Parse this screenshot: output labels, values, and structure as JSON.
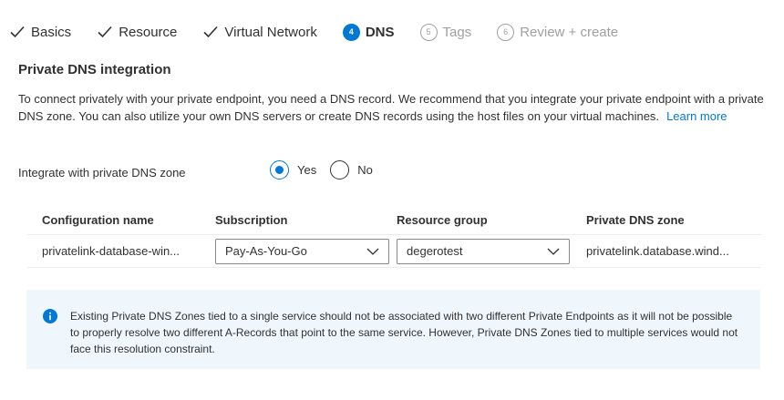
{
  "tabs": [
    {
      "label": "Basics",
      "state": "complete"
    },
    {
      "label": "Resource",
      "state": "complete"
    },
    {
      "label": "Virtual Network",
      "state": "complete"
    },
    {
      "label": "DNS",
      "state": "active",
      "step": "4"
    },
    {
      "label": "Tags",
      "state": "disabled",
      "step": "5"
    },
    {
      "label": "Review + create",
      "state": "disabled",
      "step": "6"
    }
  ],
  "section": {
    "title": "Private DNS integration",
    "description": "To connect privately with your private endpoint, you need a DNS record. We recommend that you integrate your private endpoint with a private DNS zone. You can also utilize your own DNS servers or create DNS records using the host files on your virtual machines.",
    "learn_more": "Learn more"
  },
  "integrate": {
    "label": "Integrate with private DNS zone",
    "options": {
      "yes": "Yes",
      "no": "No"
    },
    "selected": "yes"
  },
  "table": {
    "headers": {
      "config_name": "Configuration name",
      "subscription": "Subscription",
      "resource_group": "Resource group",
      "private_dns_zone": "Private DNS zone"
    },
    "rows": [
      {
        "config_name": "privatelink-database-win...",
        "subscription": "Pay-As-You-Go",
        "resource_group": "degerotest",
        "private_dns_zone": "privatelink.database.wind..."
      }
    ]
  },
  "info": {
    "icon": "info-icon",
    "text": "Existing Private DNS Zones tied to a single service should not be associated with two different Private Endpoints as it will not be possible to properly resolve two different A-Records that point to the same service. However, Private DNS Zones tied to multiple services would not face this resolution constraint."
  },
  "colors": {
    "accent": "#0078d4",
    "info_bg": "#eff6fc",
    "disabled": "#a19f9d"
  }
}
